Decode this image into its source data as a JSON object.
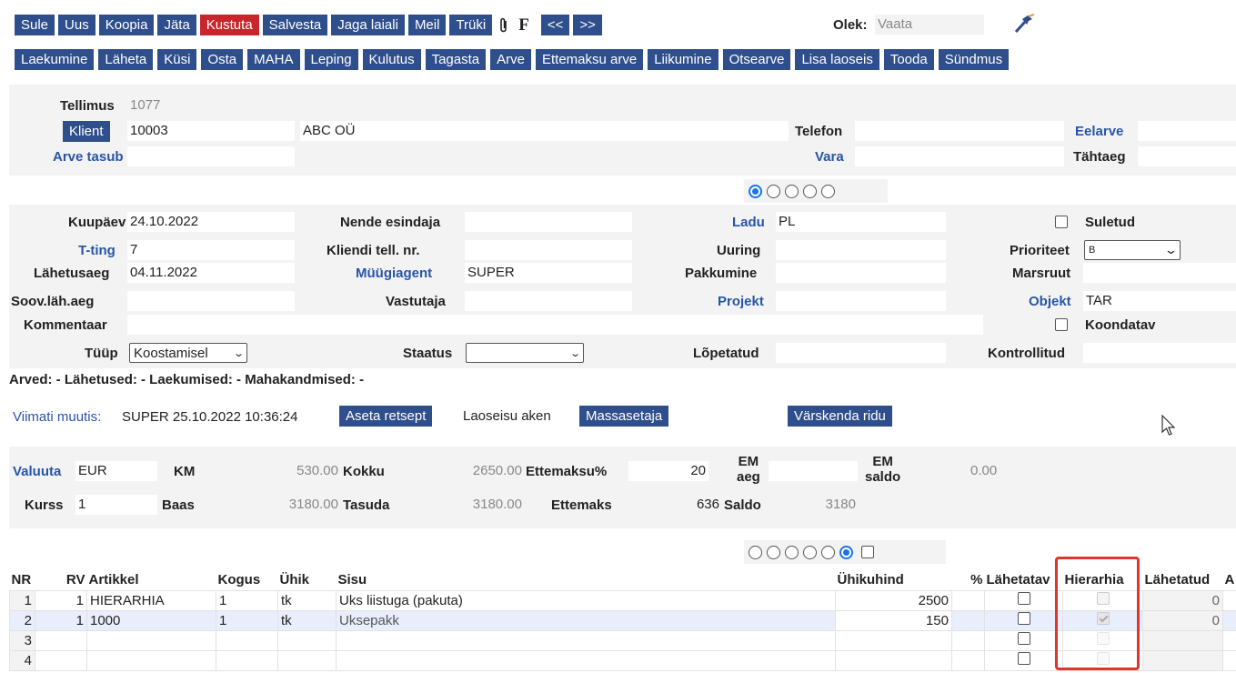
{
  "toolbar1": {
    "buttons": [
      "Sule",
      "Uus",
      "Koopia",
      "Jäta",
      "Kustuta",
      "Salvesta",
      "Jaga laiali",
      "Meil",
      "Trüki"
    ],
    "f_label": "F",
    "prev": "<<",
    "next": ">>",
    "olek_label": "Olek:",
    "olek_value": "Vaata"
  },
  "toolbar2": {
    "buttons": [
      "Laekumine",
      "Läheta",
      "Küsi",
      "Osta",
      "MAHA",
      "Leping",
      "Kulutus",
      "Tagasta",
      "Arve",
      "Ettemaksu arve",
      "Liikumine",
      "Otsearve",
      "Lisa laoseis",
      "Tooda",
      "Sündmus"
    ]
  },
  "header": {
    "tellimus_label": "Tellimus",
    "tellimus_value": "1077",
    "klient_label": "Klient",
    "klient_code": "10003",
    "klient_name": "ABC OÜ",
    "telefon_label": "Telefon",
    "telefon_value": "",
    "eelarve_label": "Eelarve",
    "arve_tasub_label": "Arve tasub",
    "vara_label": "Vara",
    "tahtaeg_label": "Tähtaeg"
  },
  "details": {
    "kuupaev_label": "Kuupäev",
    "kuupaev_value": "24.10.2022",
    "tting_label": "T-ting",
    "tting_value": "7",
    "lahetusaeg_label": "Lähetusaeg",
    "lahetusaeg_value": "04.11.2022",
    "soov_label": "Soov.läh.aeg",
    "kommentaar_label": "Kommentaar",
    "tuup_label": "Tüüp",
    "tuup_value": "Koostamisel",
    "nende_label": "Nende esindaja",
    "kliendi_label": "Kliendi tell. nr.",
    "myygiagent_label": "Müügiagent",
    "myygiagent_value": "SUPER",
    "vastutaja_label": "Vastutaja",
    "staatus_label": "Staatus",
    "staatus_value": "",
    "ladu_label": "Ladu",
    "ladu_value": "PL",
    "uuring_label": "Uuring",
    "pakkumine_label": "Pakkumine",
    "projekt_label": "Projekt",
    "lopetatud_label": "Lõpetatud",
    "suletud_label": "Suletud",
    "prioriteet_label": "Prioriteet",
    "prioriteet_value": "B",
    "marsruut_label": "Marsruut",
    "objekt_label": "Objekt",
    "objekt_value": "TAR",
    "koondatav_label": "Koondatav",
    "kontrollitud_label": "Kontrollitud"
  },
  "links_line": "Arved: - Lähetused: - Laekumised: - Mahakandmised: -",
  "viimati": {
    "label": "Viimati muutis:",
    "value": "SUPER 25.10.2022 10:36:24",
    "aseta": "Aseta retsept",
    "laoseisu": "Laoseisu aken",
    "massasetaja": "Massasetaja",
    "varskenda": "Värskenda ridu"
  },
  "totals": {
    "valuuta_label": "Valuuta",
    "valuuta_value": "EUR",
    "km_label": "KM",
    "km_value": "530.00",
    "kokku_label": "Kokku",
    "kokku_value": "2650.00",
    "ettemaksu_pct_label": "Ettemaksu%",
    "ettemaksu_pct_value": "20",
    "em_aeg_label_1": "EM",
    "em_aeg_label_2": "aeg",
    "em_saldo_label_1": "EM",
    "em_saldo_label_2": "saldo",
    "em_saldo_value": "0.00",
    "kurss_label": "Kurss",
    "kurss_value": "1",
    "baas_label": "Baas",
    "baas_value": "3180.00",
    "tasuda_label": "Tasuda",
    "tasuda_value": "3180.00",
    "ettemaks_label": "Ettemaks",
    "ettemaks_value": "636",
    "saldo_label": "Saldo",
    "saldo_value": "3180"
  },
  "grid": {
    "columns": [
      "NR",
      "RV",
      "Artikkel",
      "Kogus",
      "Ühik",
      "Sisu",
      "Ühikuhind",
      "%",
      "Lähetatav",
      "Hierarhia",
      "Lähetatud"
    ],
    "rows": [
      {
        "nr": "1",
        "rv": "1",
        "artikkel": "HIERARHIA",
        "kogus": "1",
        "uhik": "tk",
        "sisu": "Uks liistuga (pakuta)",
        "hind": "2500",
        "lahetatud": "0"
      },
      {
        "nr": "2",
        "rv": "1",
        "artikkel": "1000",
        "kogus": "1",
        "uhik": "tk",
        "sisu": "Uksepakk",
        "hind": "150",
        "lahetatud": "0"
      },
      {
        "nr": "3",
        "rv": "",
        "artikkel": "",
        "kogus": "",
        "uhik": "",
        "sisu": "",
        "hind": "",
        "lahetatud": ""
      },
      {
        "nr": "4",
        "rv": "",
        "artikkel": "",
        "kogus": "",
        "uhik": "",
        "sisu": "",
        "hind": "",
        "lahetatud": ""
      }
    ]
  },
  "colors": {
    "button": "#2f4f8c",
    "delete": "#c8262c",
    "link": "#2855a8",
    "highlight": "#e0352b",
    "panel": "#f3f3f3"
  }
}
